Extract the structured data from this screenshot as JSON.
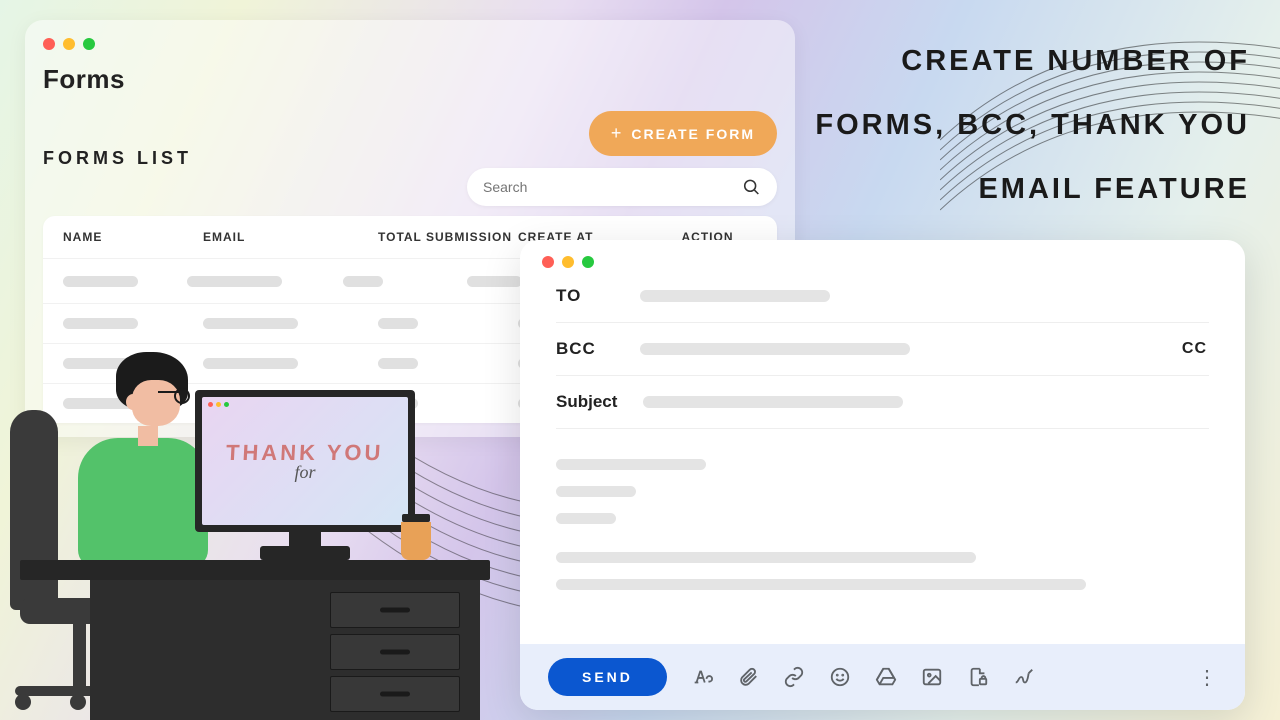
{
  "hero": "CREATE NUMBER OF FORMS, BCC, THANK YOU EMAIL FEATURE",
  "forms": {
    "title": "Forms",
    "listHeading": "FORMS LIST",
    "createBtn": "CREATE FORM",
    "searchPlaceholder": "Search",
    "columns": {
      "name": "NAME",
      "email": "EMAIL",
      "total": "TOTAL SUBMISSION",
      "create": "CREATE AT",
      "action": "ACTION"
    }
  },
  "email": {
    "to": "TO",
    "bcc": "BCC",
    "cc": "CC",
    "subject": "Subject",
    "send": "SEND"
  },
  "thankYou": {
    "line1": "THANK YOU",
    "line2": "for"
  }
}
